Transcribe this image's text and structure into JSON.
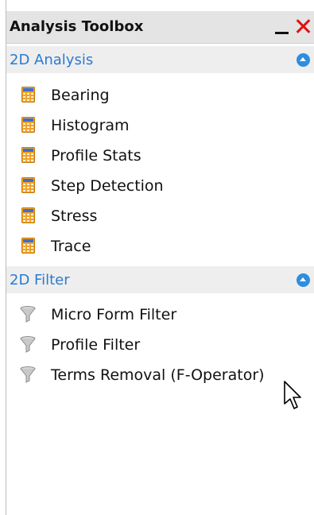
{
  "panel": {
    "title": "Analysis Toolbox",
    "minimize_icon": "minimize-icon",
    "close_icon": "close-icon"
  },
  "sections": [
    {
      "title": "2D Analysis",
      "expanded": true,
      "item_icon": "calculator-icon",
      "items": [
        {
          "label": "Bearing"
        },
        {
          "label": "Histogram"
        },
        {
          "label": "Profile Stats"
        },
        {
          "label": "Step Detection"
        },
        {
          "label": "Stress"
        },
        {
          "label": "Trace"
        }
      ]
    },
    {
      "title": "2D Filter",
      "expanded": true,
      "item_icon": "funnel-filter-icon",
      "items": [
        {
          "label": "Micro Form Filter"
        },
        {
          "label": "Profile Filter"
        },
        {
          "label": "Terms Removal (F-Operator)"
        }
      ]
    }
  ],
  "colors": {
    "section_title": "#2a7bd1",
    "collapse_button": "#2d8ee0",
    "close_x": "#e01010",
    "calculator_body": "#f0a22a",
    "calculator_screen": "#3b6fcf",
    "titlebar_bg": "#e4e4e4",
    "section_bg": "#eeeeee"
  }
}
